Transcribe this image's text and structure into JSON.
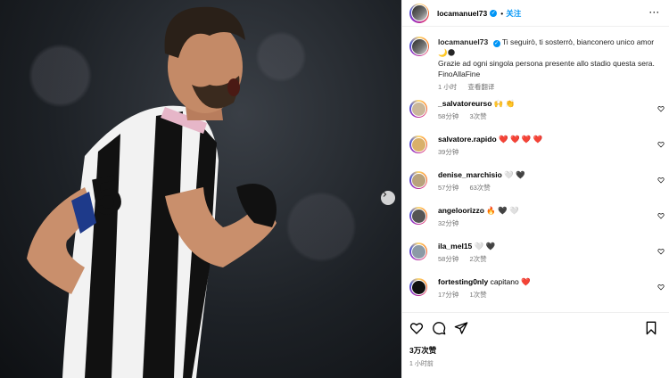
{
  "post": {
    "username": "locamanuel73",
    "follow_label": "关注",
    "more_label": "···",
    "caption_line1": "Ti seguirò, ti sosterrò, bianconero unico amor",
    "caption_line2": "🌙🌑",
    "caption_line3": "Grazie ad ogni singola persona presente allo stadio questa sera.",
    "caption_line4": "FinoAllaFine",
    "caption_time": "1 小时",
    "translate_label": "查看翻译",
    "likes": "3万次赞",
    "posted_time": "1 小时前"
  },
  "comments": [
    {
      "user": "_salvatoreurso",
      "text": "🙌 👏",
      "time": "58分钟",
      "likes": "3次赞",
      "avatar_color": "#c9b79a"
    },
    {
      "user": "salvatore.rapido",
      "text": "❤️ ❤️ ❤️ ❤️",
      "time": "39分钟",
      "likes": "",
      "avatar_color": "#d9b06a"
    },
    {
      "user": "denise_marchisio",
      "text": "🤍 🖤",
      "time": "57分钟",
      "likes": "63次赞",
      "avatar_color": "#b8a27c"
    },
    {
      "user": "angeloorizzo",
      "text": "🔥 🖤 🤍",
      "time": "32分钟",
      "likes": "",
      "avatar_color": "#555555"
    },
    {
      "user": "ila_mel15",
      "text": "🤍 🖤",
      "time": "58分钟",
      "likes": "2次赞",
      "avatar_color": "#8c9aa6"
    },
    {
      "user": "fortesting0nly",
      "text": "capitano ❤️",
      "time": "17分钟",
      "likes": "1次赞",
      "avatar_color": "#111111"
    }
  ],
  "colors": {
    "accent": "#0095f6",
    "heart": "#ed4956"
  },
  "icons": [
    "heart-icon",
    "comment-icon",
    "share-icon",
    "bookmark-icon",
    "chevron-right-icon",
    "verified-icon"
  ]
}
